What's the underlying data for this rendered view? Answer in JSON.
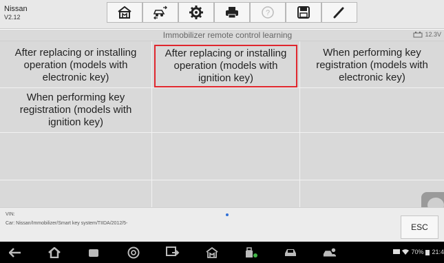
{
  "app": {
    "name": "Nissan",
    "version": "V2.12"
  },
  "toolbar": {
    "buttons": [
      {
        "name": "home",
        "icon": "home-icon"
      },
      {
        "name": "vehicle-swap",
        "icon": "car-swap-icon"
      },
      {
        "name": "settings",
        "icon": "gear-icon"
      },
      {
        "name": "print",
        "icon": "printer-icon"
      },
      {
        "name": "help",
        "icon": "help-icon"
      },
      {
        "name": "save",
        "icon": "save-icon"
      },
      {
        "name": "edit",
        "icon": "pen-icon"
      }
    ]
  },
  "header": {
    "title": "Immobilizer remote control learning",
    "voltage": "12.3V"
  },
  "grid": {
    "cells": [
      "After replacing or installing operation (models with electronic key)",
      "After replacing or installing operation (models with ignition key)",
      "When performing key registration (models with electronic key)",
      "When performing key registration (models with ignition key)"
    ],
    "selected_index": 1
  },
  "footer": {
    "vin_label": "VIN:",
    "car_path": "Car: Nissan/Immobilizer/Smart key system/TIIDA/2012/5-",
    "esc_label": "ESC"
  },
  "status_bar": {
    "battery": "70%",
    "time": "21:4"
  },
  "colors": {
    "selection": "#e0262d",
    "page_indicator": "#2f6fd6"
  }
}
